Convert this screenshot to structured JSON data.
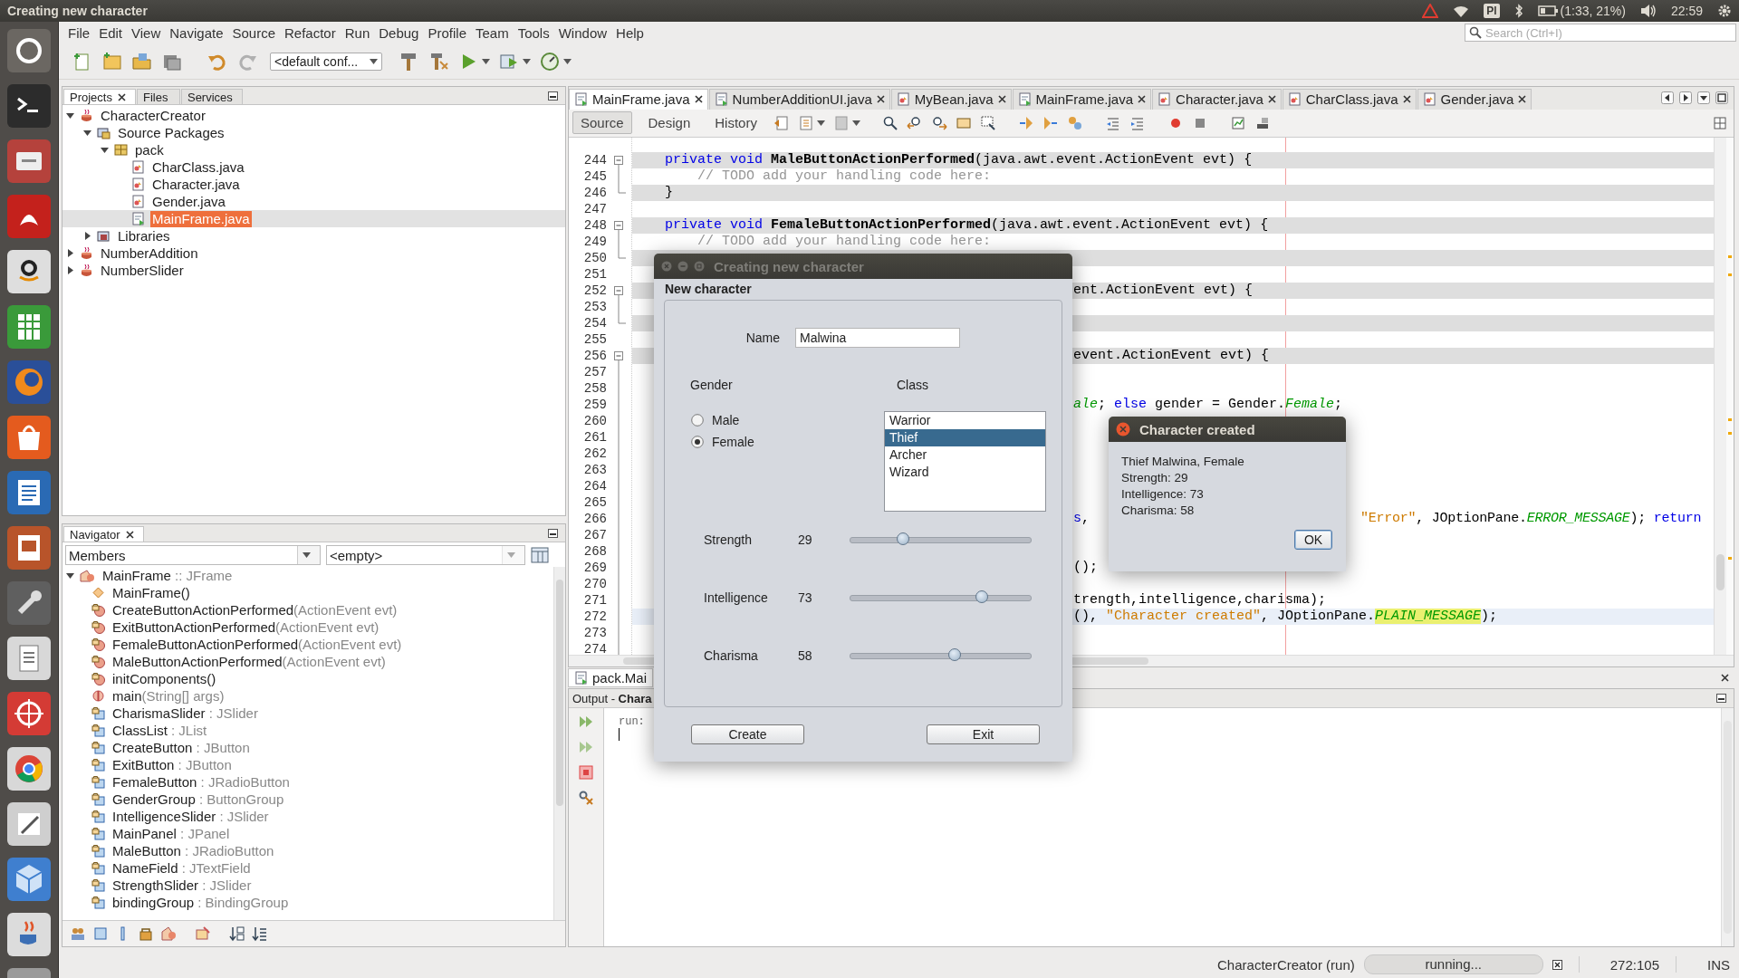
{
  "top_panel": {
    "title": "Creating new character",
    "keyboard": "Pl",
    "battery": "(1:33, 21%)",
    "clock": "22:59"
  },
  "menu": [
    "File",
    "Edit",
    "View",
    "Navigate",
    "Source",
    "Refactor",
    "Run",
    "Debug",
    "Profile",
    "Team",
    "Tools",
    "Window",
    "Help"
  ],
  "search": {
    "placeholder": "Search (Ctrl+I)"
  },
  "toolbar": {
    "configuration": "<default conf..."
  },
  "projects": {
    "tabs": [
      {
        "label": "Projects",
        "selected": true,
        "closable": true
      },
      {
        "label": "Files",
        "selected": false,
        "closable": false
      },
      {
        "label": "Services",
        "selected": false,
        "closable": false
      }
    ],
    "tree": [
      {
        "label": "CharacterCreator",
        "kind": "project",
        "expanded": true,
        "selected": false,
        "children": [
          {
            "label": "Source Packages",
            "kind": "packages",
            "expanded": true,
            "selected": false,
            "children": [
              {
                "label": "pack",
                "kind": "package",
                "expanded": true,
                "selected": false,
                "children": [
                  {
                    "label": "CharClass.java",
                    "kind": "java",
                    "selected": false
                  },
                  {
                    "label": "Character.java",
                    "kind": "java",
                    "selected": false
                  },
                  {
                    "label": "Gender.java",
                    "kind": "java",
                    "selected": false
                  },
                  {
                    "label": "MainFrame.java",
                    "kind": "form",
                    "selected": true
                  }
                ]
              }
            ]
          },
          {
            "label": "Libraries",
            "kind": "libraries",
            "expanded": false,
            "selected": false
          }
        ]
      },
      {
        "label": "NumberAddition",
        "kind": "project",
        "expanded": false,
        "selected": false
      },
      {
        "label": "NumberSlider",
        "kind": "project",
        "expanded": false,
        "selected": false
      }
    ]
  },
  "navigator": {
    "tab": "Navigator",
    "filter": "Members",
    "scope": "<empty>",
    "root": {
      "label": "MainFrame",
      "detail": " :: JFrame",
      "expanded": true
    },
    "members": [
      {
        "label": "MainFrame()",
        "kind": "constructor"
      },
      {
        "label": "CreateButtonActionPerformed",
        "detail": "(ActionEvent evt)",
        "kind": "method"
      },
      {
        "label": "ExitButtonActionPerformed",
        "detail": "(ActionEvent evt)",
        "kind": "method"
      },
      {
        "label": "FemaleButtonActionPerformed",
        "detail": "(ActionEvent evt)",
        "kind": "method"
      },
      {
        "label": "MaleButtonActionPerformed",
        "detail": "(ActionEvent evt)",
        "kind": "method"
      },
      {
        "label": "initComponents()",
        "kind": "method"
      },
      {
        "label": "main",
        "detail": "(String[] args)",
        "kind": "static"
      },
      {
        "label": "CharismaSlider",
        "detail": " : JSlider",
        "kind": "field"
      },
      {
        "label": "ClassList",
        "detail": " : JList",
        "kind": "field"
      },
      {
        "label": "CreateButton",
        "detail": " : JButton",
        "kind": "field"
      },
      {
        "label": "ExitButton",
        "detail": " : JButton",
        "kind": "field"
      },
      {
        "label": "FemaleButton",
        "detail": " : JRadioButton",
        "kind": "field"
      },
      {
        "label": "GenderGroup",
        "detail": " : ButtonGroup",
        "kind": "field"
      },
      {
        "label": "IntelligenceSlider",
        "detail": " : JSlider",
        "kind": "field"
      },
      {
        "label": "MainPanel",
        "detail": " : JPanel",
        "kind": "field"
      },
      {
        "label": "MaleButton",
        "detail": " : JRadioButton",
        "kind": "field"
      },
      {
        "label": "NameField",
        "detail": " : JTextField",
        "kind": "field"
      },
      {
        "label": "StrengthSlider",
        "detail": " : JSlider",
        "kind": "field"
      },
      {
        "label": "bindingGroup",
        "detail": " : BindingGroup",
        "kind": "field"
      }
    ]
  },
  "editor": {
    "tabs": [
      {
        "label": "MainFrame.java",
        "kind": "form",
        "selected": true
      },
      {
        "label": "NumberAdditionUI.java",
        "kind": "form",
        "selected": false
      },
      {
        "label": "MyBean.java",
        "kind": "java",
        "selected": false
      },
      {
        "label": "MainFrame.java",
        "kind": "form",
        "selected": false
      },
      {
        "label": "Character.java",
        "kind": "java",
        "selected": false
      },
      {
        "label": "CharClass.java",
        "kind": "java",
        "selected": false
      },
      {
        "label": "Gender.java",
        "kind": "java",
        "selected": false
      }
    ],
    "views": [
      {
        "label": "Source",
        "selected": true
      },
      {
        "label": "Design",
        "selected": false
      },
      {
        "label": "History",
        "selected": false
      }
    ],
    "lines": [
      {
        "number": "244",
        "guarded": true,
        "current": false,
        "fold_start": true,
        "fold_end": false,
        "segments": [
          {
            "kind": "lead",
            "tokens": [
              {
                "kind": "keyword",
                "text": "    private void "
              },
              {
                "kind": "method",
                "text": "MaleButtonActionPerformed"
              },
              {
                "kind": "plain",
                "text": "(java.awt.event.ActionEvent evt) {"
              }
            ]
          }
        ]
      },
      {
        "number": "245",
        "guarded": false,
        "current": false,
        "fold_start": false,
        "fold_end": false,
        "segments": [
          {
            "kind": "lead",
            "tokens": [
              {
                "kind": "comment",
                "text": "        // TODO add your handling code here:"
              }
            ]
          }
        ]
      },
      {
        "number": "246",
        "guarded": true,
        "current": false,
        "fold_start": false,
        "fold_end": true,
        "segments": [
          {
            "kind": "lead",
            "tokens": [
              {
                "kind": "plain",
                "text": "    }"
              }
            ]
          }
        ]
      },
      {
        "number": "247",
        "guarded": false,
        "current": false,
        "fold_start": false,
        "fold_end": false
      },
      {
        "number": "248",
        "guarded": true,
        "current": false,
        "fold_start": true,
        "fold_end": false,
        "segments": [
          {
            "kind": "lead",
            "tokens": [
              {
                "kind": "keyword",
                "text": "    private void "
              },
              {
                "kind": "method",
                "text": "FemaleButtonActionPerformed"
              },
              {
                "kind": "plain",
                "text": "(java.awt.event.ActionEvent evt) {"
              }
            ]
          }
        ]
      },
      {
        "number": "249",
        "guarded": false,
        "current": false,
        "fold_start": false,
        "fold_end": false,
        "segments": [
          {
            "kind": "lead",
            "tokens": [
              {
                "kind": "comment",
                "text": "        // TODO add your handling code here:"
              }
            ]
          }
        ]
      },
      {
        "number": "250",
        "guarded": true,
        "current": false,
        "fold_start": false,
        "fold_end": true
      },
      {
        "number": "251",
        "guarded": false,
        "current": false,
        "fold_start": false,
        "fold_end": false
      },
      {
        "number": "252",
        "guarded": true,
        "current": false,
        "fold_start": true,
        "fold_end": false,
        "segments": [
          {
            "kind": "after-dialog",
            "tokens": [
              {
                "kind": "plain",
                "text": "ent.ActionEvent evt) {"
              }
            ]
          }
        ]
      },
      {
        "number": "253",
        "guarded": false,
        "current": false,
        "fold_start": false,
        "fold_end": false
      },
      {
        "number": "254",
        "guarded": true,
        "current": false,
        "fold_start": false,
        "fold_end": true
      },
      {
        "number": "255",
        "guarded": false,
        "current": false,
        "fold_start": false,
        "fold_end": false
      },
      {
        "number": "256",
        "guarded": true,
        "current": false,
        "fold_start": true,
        "fold_end": false,
        "segments": [
          {
            "kind": "after-dialog",
            "tokens": [
              {
                "kind": "plain",
                "text": "event.ActionEvent evt) {"
              }
            ]
          }
        ]
      },
      {
        "number": "257",
        "guarded": false,
        "current": false,
        "fold_start": false,
        "fold_end": false
      },
      {
        "number": "258",
        "guarded": false,
        "current": false,
        "fold_start": false,
        "fold_end": false
      },
      {
        "number": "259",
        "guarded": false,
        "current": false,
        "fold_start": false,
        "fold_end": false,
        "segments": [
          {
            "kind": "after-dialog",
            "tokens": [
              {
                "kind": "field",
                "text": "ale"
              },
              {
                "kind": "plain",
                "text": "; "
              },
              {
                "kind": "keyword",
                "text": "else"
              },
              {
                "kind": "plain",
                "text": " gender = Gender."
              },
              {
                "kind": "field",
                "text": "Female"
              },
              {
                "kind": "plain",
                "text": ";"
              }
            ]
          }
        ]
      },
      {
        "number": "260",
        "guarded": false,
        "current": false,
        "fold_start": false,
        "fold_end": false
      },
      {
        "number": "261",
        "guarded": false,
        "current": false,
        "fold_start": false,
        "fold_end": false
      },
      {
        "number": "262",
        "guarded": false,
        "current": false,
        "fold_start": false,
        "fold_end": false
      },
      {
        "number": "263",
        "guarded": false,
        "current": false,
        "fold_start": false,
        "fold_end": false
      },
      {
        "number": "264",
        "guarded": false,
        "current": false,
        "fold_start": false,
        "fold_end": false
      },
      {
        "number": "265",
        "guarded": false,
        "current": false,
        "fold_start": false,
        "fold_end": false
      },
      {
        "number": "266",
        "guarded": false,
        "current": false,
        "fold_start": false,
        "fold_end": false,
        "segments": [
          {
            "kind": "after-dialog",
            "tokens": [
              {
                "kind": "keyword",
                "text": "s"
              },
              {
                "kind": "plain",
                "text": ","
              }
            ]
          },
          {
            "kind": "after-message",
            "tokens": [
              {
                "kind": "string",
                "text": "\"Error\""
              },
              {
                "kind": "plain",
                "text": ", JOptionPane."
              },
              {
                "kind": "field",
                "text": "ERROR_MESSAGE"
              },
              {
                "kind": "plain",
                "text": "); "
              },
              {
                "kind": "keyword",
                "text": "return"
              }
            ]
          }
        ]
      },
      {
        "number": "267",
        "guarded": false,
        "current": false,
        "fold_start": false,
        "fold_end": false
      },
      {
        "number": "268",
        "guarded": false,
        "current": false,
        "fold_start": false,
        "fold_end": false
      },
      {
        "number": "269",
        "guarded": false,
        "current": false,
        "fold_start": false,
        "fold_end": false,
        "segments": [
          {
            "kind": "after-dialog",
            "tokens": [
              {
                "kind": "plain",
                "text": "();"
              }
            ]
          }
        ]
      },
      {
        "number": "270",
        "guarded": false,
        "current": false,
        "fold_start": false,
        "fold_end": false
      },
      {
        "number": "271",
        "guarded": false,
        "current": false,
        "fold_start": false,
        "fold_end": false,
        "segments": [
          {
            "kind": "after-dialog",
            "tokens": [
              {
                "kind": "plain",
                "text": "trength,intelligence,charisma);"
              }
            ]
          }
        ]
      },
      {
        "number": "272",
        "guarded": false,
        "current": true,
        "fold_start": false,
        "fold_end": false,
        "segments": [
          {
            "kind": "after-dialog",
            "tokens": [
              {
                "kind": "plain",
                "text": "(), "
              },
              {
                "kind": "string",
                "text": "\"Character created\""
              },
              {
                "kind": "plain",
                "text": ", JOptionPane."
              },
              {
                "kind": "marked",
                "text": "PLAIN_MESSAGE"
              },
              {
                "kind": "plain",
                "text": ");"
              }
            ]
          }
        ]
      },
      {
        "number": "273",
        "guarded": false,
        "current": false,
        "fold_start": false,
        "fold_end": false
      },
      {
        "number": "274",
        "guarded": false,
        "current": false,
        "fold_start": false,
        "fold_end": false
      }
    ]
  },
  "bottom_tab": "pack.Mai",
  "output": {
    "title": "Output - **Chara**",
    "lines": [
      "run:"
    ]
  },
  "status": {
    "task": "CharacterCreator (run)",
    "progress": "running...",
    "position": "272:105",
    "mode": "INS"
  },
  "form_dialog": {
    "title": "Creating new character",
    "heading": "New character",
    "name_label": "Name",
    "name_value": "Malwina",
    "gender_label": "Gender",
    "genders": [
      {
        "label": "Male",
        "selected": false
      },
      {
        "label": "Female",
        "selected": true
      }
    ],
    "class_label": "Class",
    "classes": [
      {
        "label": "Warrior",
        "selected": false
      },
      {
        "label": "Thief",
        "selected": true
      },
      {
        "label": "Archer",
        "selected": false
      },
      {
        "label": "Wizard",
        "selected": false
      }
    ],
    "stats": [
      {
        "label": "Strength",
        "value": "29",
        "level": 0.29
      },
      {
        "label": "Intelligence",
        "value": "73",
        "level": 0.73
      },
      {
        "label": "Charisma",
        "value": "58",
        "level": 0.58
      }
    ],
    "buttons": [
      "Create",
      "Exit"
    ]
  },
  "message_dialog": {
    "title": "Character created",
    "lines": [
      "Thief Malwina, Female",
      "Strength: 29",
      "Intelligence: 73",
      "Charisma: 58"
    ],
    "button": "OK"
  }
}
